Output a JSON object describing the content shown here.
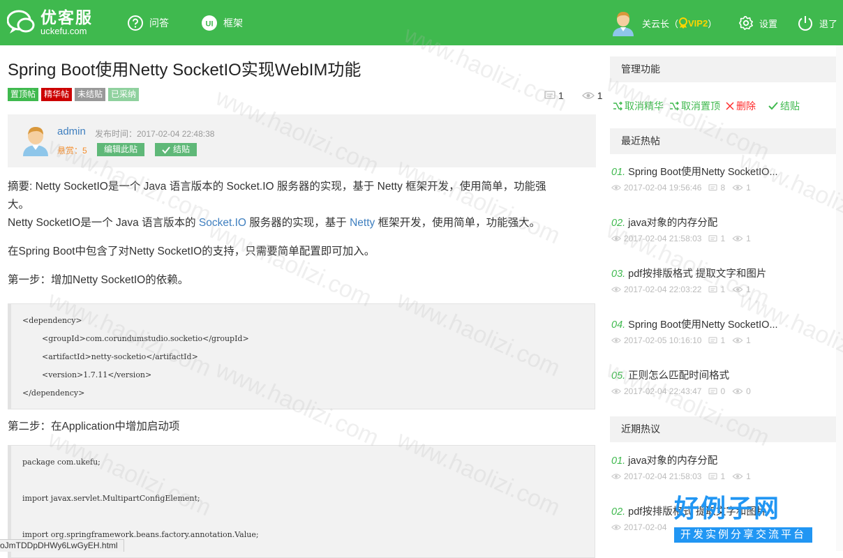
{
  "header": {
    "logo_name": "优客服",
    "logo_sub": "uckefu.com",
    "nav": [
      {
        "label": "问答",
        "icon": "question-icon"
      },
      {
        "label": "框架",
        "icon": "ui-icon"
      }
    ],
    "user_name": "关云长（",
    "vip_label": "VIP2",
    "user_suffix": "）",
    "settings_label": "设置",
    "logout_label": "退了",
    "brand_color": "#3fb94e"
  },
  "post": {
    "title": "Spring Boot使用Netty SocketIO实现WebIM功能",
    "tags": [
      {
        "label": "置顶帖",
        "color": "#3fb94e"
      },
      {
        "label": "精华帖",
        "color": "#cc0000"
      },
      {
        "label": "未结贴",
        "color": "#999999"
      },
      {
        "label": "已采纳",
        "color": "#8fd19e"
      }
    ],
    "comments": "1",
    "views": "1",
    "author": "admin",
    "published": "发布时间：2017-02-04 22:48:38",
    "reward": "悬赏：5",
    "edit_label": "编辑此贴",
    "close_label": "结贴"
  },
  "content": {
    "summary_1": "摘要: Netty SocketIO是一个 Java 语言版本的 Socket.IO 服务器的实现，基于 Netty 框架开发，使用简单，功能强",
    "summary_2": "大。",
    "para_a": "Netty SocketIO是一个 Java 语言版本的 ",
    "link_socketio": "Socket.IO",
    "para_b": " 服务器的实现，基于 ",
    "link_netty": "Netty",
    "para_c": " 框架开发，使用简单，功能强大。",
    "para_2": "在Spring Boot中包含了对Netty SocketIO的支持，只需要简单配置即可加入。",
    "step_1": "第一步：增加Netty SocketIO的依赖。",
    "code_1": [
      "<dependency>",
      "        <groupId>com.corundumstudio.socketio</groupId>",
      "        <artifactId>netty-socketio</artifactId>",
      "        <version>1.7.11</version>",
      "</dependency>"
    ],
    "step_2": "第二步：在Application中增加启动项",
    "code_2": [
      "package com.ukefu;",
      "import javax.servlet.MultipartConfigElement;",
      "import org.springframework.beans.factory.annotation.Value;"
    ]
  },
  "sidebar": {
    "admin_title": "管理功能",
    "actions": [
      {
        "label": "取消精华",
        "kind": "unstar"
      },
      {
        "label": "取消置顶",
        "kind": "unpin"
      },
      {
        "label": "删除",
        "kind": "delete"
      },
      {
        "label": "结贴",
        "kind": "close"
      }
    ],
    "recent_title": "最近热帖",
    "recent": [
      {
        "idx": "01.",
        "title": "Spring Boot使用Netty SocketIO...",
        "time": "2017-02-04 19:56:46",
        "comments": "8",
        "views": "1"
      },
      {
        "idx": "02.",
        "title": "java对象的内存分配",
        "time": "2017-02-04 21:58:03",
        "comments": "1",
        "views": "1"
      },
      {
        "idx": "03.",
        "title": "pdf按排版格式 提取文字和图片",
        "time": "2017-02-04 22:03:22",
        "comments": "1",
        "views": "1"
      },
      {
        "idx": "04.",
        "title": "Spring Boot使用Netty SocketIO...",
        "time": "2017-02-05 10:16:10",
        "comments": "1",
        "views": "1"
      },
      {
        "idx": "05.",
        "title": "正则怎么匹配时间格式",
        "time": "2017-02-04 22:43:47",
        "comments": "0",
        "views": "0"
      }
    ],
    "qa_title": "近期热议",
    "qa": [
      {
        "idx": "01.",
        "title": "java对象的内存分配",
        "time": "2017-02-04 21:58:03",
        "comments": "1",
        "views": "1"
      },
      {
        "idx": "02.",
        "title": "pdf按排版格式 提取文字和图片",
        "time": "2017-02-04",
        "comments": "",
        "views": ""
      }
    ]
  },
  "overlay": {
    "watermark_text": "www.haolizi.com",
    "status_url": "oJmTDDpDHWy6LwGyEH.html",
    "brand_big": "好例子网",
    "brand_small": "开发实例分享交流平台"
  }
}
